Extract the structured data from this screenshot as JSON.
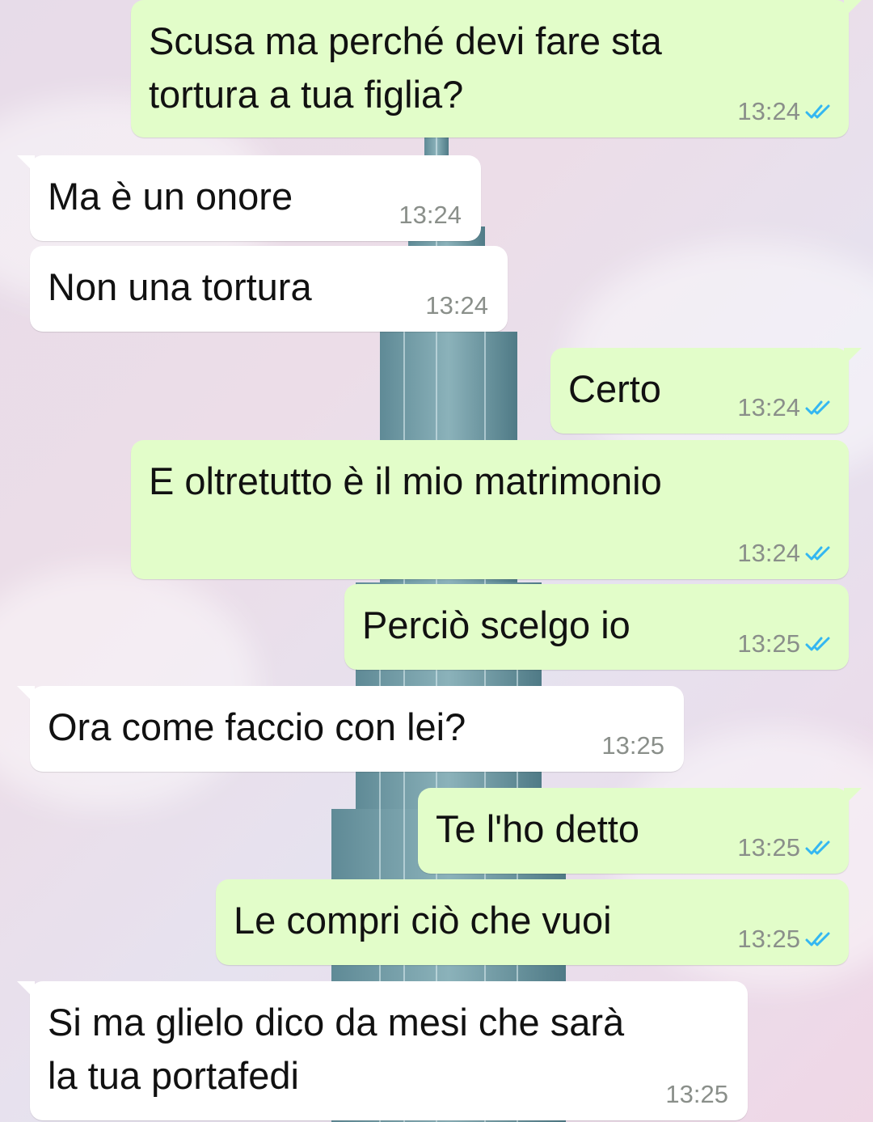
{
  "colors": {
    "outgoing_bubble": "#e2fdc9",
    "incoming_bubble": "#ffffff",
    "read_tick": "#34b7f1",
    "timestamp": "#8a8f8a"
  },
  "messages": [
    {
      "direction": "outgoing",
      "text": "Scusa ma perché devi fare sta\ntortura a tua figlia?",
      "time": "13:24",
      "status": "read"
    },
    {
      "direction": "incoming",
      "text": "Ma è un onore",
      "time": "13:24"
    },
    {
      "direction": "incoming",
      "text": "Non una tortura",
      "time": "13:24"
    },
    {
      "direction": "outgoing",
      "text": "Certo",
      "time": "13:24",
      "status": "read"
    },
    {
      "direction": "outgoing",
      "text": "E oltretutto è il mio matrimonio",
      "time": "13:24",
      "status": "read"
    },
    {
      "direction": "outgoing",
      "text": "Perciò scelgo io",
      "time": "13:25",
      "status": "read"
    },
    {
      "direction": "incoming",
      "text": "Ora come faccio con lei?",
      "time": "13:25"
    },
    {
      "direction": "outgoing",
      "text": "Te l'ho detto",
      "time": "13:25",
      "status": "read"
    },
    {
      "direction": "outgoing",
      "text": "Le compri ciò che vuoi",
      "time": "13:25",
      "status": "read"
    },
    {
      "direction": "incoming",
      "text": "Si ma glielo dico da mesi che sarà\nla tua portafedi",
      "time": "13:25"
    }
  ]
}
